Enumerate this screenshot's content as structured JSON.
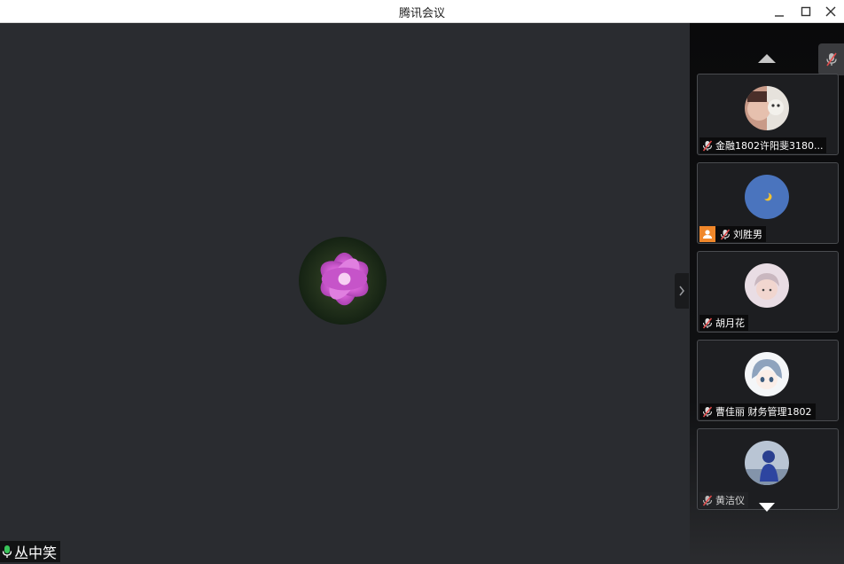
{
  "window": {
    "title": "腾讯会议"
  },
  "main": {
    "speaker_name": "丛中笑"
  },
  "participants": [
    {
      "name": "金融1802许阳斐3180...",
      "muted": true,
      "host": false
    },
    {
      "name": "刘胜男",
      "muted": true,
      "host": true
    },
    {
      "name": "胡月花",
      "muted": true,
      "host": false
    },
    {
      "name": "曹佳丽 财务管理1802",
      "muted": true,
      "host": false
    },
    {
      "name": "黄洁仪",
      "muted": true,
      "host": false
    }
  ],
  "colors": {
    "main_bg": "#2a2c30",
    "sidebar_bg": "#0f1012",
    "host_badge": "#f0872a",
    "mute_red": "#e04a4a",
    "mic_green": "#39c55a"
  }
}
